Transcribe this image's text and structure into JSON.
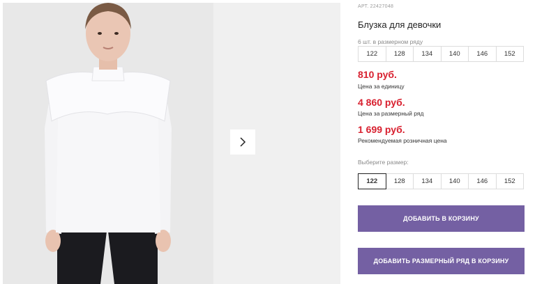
{
  "product": {
    "art_label": "АРТ.",
    "art_number": "22427048",
    "title": "Блузка для девочки"
  },
  "pack": {
    "note": "6 шт. в размерном ряду",
    "sizes": [
      "122",
      "128",
      "134",
      "140",
      "146",
      "152"
    ]
  },
  "prices": [
    {
      "value": "810 руб.",
      "label": "Цена за единицу"
    },
    {
      "value": "4 860 руб.",
      "label": "Цена за размерный ряд"
    },
    {
      "value": "1 699 руб.",
      "label": "Рекомендуемая розничная цена"
    }
  ],
  "size_select": {
    "label": "Выберите размер:",
    "sizes": [
      "122",
      "128",
      "134",
      "140",
      "146",
      "152"
    ],
    "selected": "122"
  },
  "buttons": {
    "add_to_cart": "ДОБАВИТЬ В КОРЗИНУ",
    "add_pack_to_cart": "ДОБАВИТЬ РАЗМЕРНЫЙ РЯД В КОРЗИНУ"
  },
  "gallery": {
    "next_icon": "chevron-right-icon"
  },
  "colors": {
    "price": "#d8202f",
    "button": "#7460a3",
    "gallery_bg": "#ececec"
  }
}
